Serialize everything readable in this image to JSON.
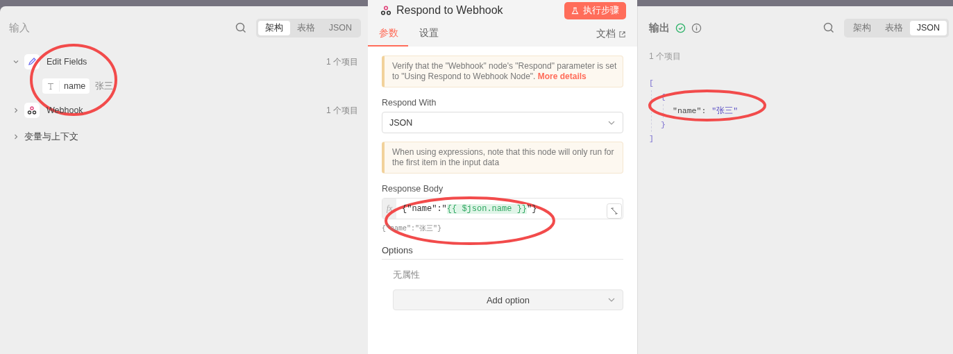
{
  "input_panel": {
    "title": "输入",
    "view_tabs": [
      {
        "label": "架构",
        "selected": true
      },
      {
        "label": "表格",
        "selected": false
      },
      {
        "label": "JSON",
        "selected": false
      }
    ],
    "tree": [
      {
        "kind": "edit",
        "label": "Edit Fields",
        "count": "1 个项目",
        "expanded": true,
        "children": [
          {
            "kind": "field",
            "label": "name",
            "value": "张三"
          }
        ]
      },
      {
        "kind": "webhook",
        "label": "Webhook",
        "count": "1 个项目",
        "expanded": false
      },
      {
        "kind": "group",
        "label": "变量与上下文",
        "expanded": false
      }
    ]
  },
  "node_panel": {
    "title": "Respond to Webhook",
    "run_button": "执行步骤",
    "tabs": [
      {
        "label": "参数",
        "selected": true
      },
      {
        "label": "设置",
        "selected": false
      }
    ],
    "docs_link": "文档",
    "notice": "Verify that the \"Webhook\" node's \"Respond\" parameter is set to \"Using Respond to Webhook Node\".",
    "notice_link": "More details",
    "respond_with": {
      "label": "Respond With",
      "value": "JSON"
    },
    "expression_notice": "When using expressions, note that this node will only run for the first item in the input data",
    "response_body": {
      "label": "Response Body",
      "prefix": "fx",
      "segments": [
        {
          "kind": "plain",
          "text": "{\"name\":\""
        },
        {
          "kind": "expression",
          "text": "{{ $json.name }}"
        },
        {
          "kind": "plain",
          "text": "\"}"
        }
      ],
      "preview": "{\"name\":\"张三\"}"
    },
    "options": {
      "label": "Options",
      "empty_text": "无属性",
      "add_button": "Add option"
    }
  },
  "output_panel": {
    "title": "输出",
    "view_tabs": [
      {
        "label": "架构",
        "selected": false
      },
      {
        "label": "表格",
        "selected": false
      },
      {
        "label": "JSON",
        "selected": true
      }
    ],
    "item_count": "1 个项目",
    "json": {
      "open": "[",
      "close": "]",
      "children": [
        {
          "open": "{",
          "close": "}",
          "pairs": [
            {
              "key": "\"name\":",
              "value": "\"张三\""
            }
          ]
        }
      ]
    }
  }
}
